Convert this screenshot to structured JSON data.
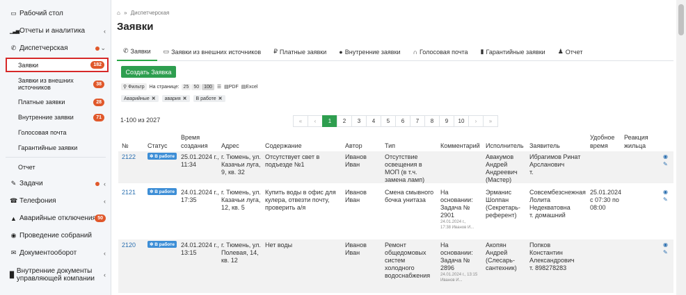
{
  "sidebar": {
    "items": [
      {
        "icon": "desktop-icon",
        "glyph": "🖵",
        "label": "Рабочий стол"
      },
      {
        "icon": "bar-chart-icon",
        "glyph": "▮",
        "label": "Отчеты и аналитика"
      },
      {
        "icon": "phone-icon",
        "glyph": "✆",
        "label": "Диспетчерская"
      }
    ],
    "dispatch_sub": [
      {
        "label": "Заявки",
        "badge": "182",
        "active": true
      },
      {
        "label": "Заявки из внешних источников",
        "badge": "38"
      },
      {
        "label": "Платные заявки",
        "badge": "28"
      },
      {
        "label": "Внутренние заявки",
        "badge": "71"
      },
      {
        "label": "Голосовая почта",
        "badge": ""
      },
      {
        "label": "Гарантийные заявки",
        "badge": ""
      },
      {
        "label": "Отчет",
        "badge": ""
      }
    ],
    "bottom_items": [
      {
        "icon": "edit-icon",
        "glyph": "✎",
        "label": "Задачи"
      },
      {
        "icon": "phone-square-icon",
        "glyph": "☎",
        "label": "Телефония"
      },
      {
        "icon": "warning-icon",
        "glyph": "▲",
        "label": "Аварийные отключения",
        "badge": "50"
      },
      {
        "icon": "users-icon",
        "glyph": "👥",
        "label": "Проведение собраний"
      },
      {
        "icon": "envelope-icon",
        "glyph": "✉",
        "label": "Документооборот"
      },
      {
        "icon": "file-icon",
        "glyph": "▉",
        "label": "Внутренние документы управляющей компании"
      }
    ]
  },
  "breadcrumb": {
    "home_icon": "home-icon",
    "sep": "»",
    "current": "Диспетчерская"
  },
  "page_title": "Заявки",
  "tabs": [
    {
      "icon": "phone-icon",
      "glyph": "✆",
      "label": "Заявки",
      "active": true
    },
    {
      "icon": "hdd-icon",
      "glyph": "▭",
      "label": "Заявки из внешних источников"
    },
    {
      "icon": "hand-icon",
      "glyph": "₽",
      "label": "Платные заявки"
    },
    {
      "icon": "info-icon",
      "glyph": "●",
      "label": "Внутренние заявки"
    },
    {
      "icon": "headset-icon",
      "glyph": "∩",
      "label": "Голосовая почта"
    },
    {
      "icon": "book-icon",
      "glyph": "▮",
      "label": "Гарантийные заявки"
    },
    {
      "icon": "user-chart-icon",
      "glyph": "♟",
      "label": "Отчет"
    }
  ],
  "create_button": "Создать Заявка",
  "toolbar": {
    "filter": "Фильтр",
    "per_page_label": "На странице:",
    "per_page_options": [
      "25",
      "50",
      "100"
    ],
    "per_page_selected": "100",
    "list_icon": "☰",
    "pdf": "PDF",
    "excel": "Excel"
  },
  "active_filters": [
    "Аварийные",
    "авария",
    "В работе"
  ],
  "range_text": "1-100 из 2027",
  "pagination": [
    "«",
    "‹",
    "1",
    "2",
    "3",
    "4",
    "5",
    "6",
    "7",
    "8",
    "9",
    "10",
    "›",
    "»"
  ],
  "pagination_active": "1",
  "table": {
    "headers": {
      "num": "№",
      "status": "Статус",
      "time1": "Время",
      "time2": "создания",
      "address": "Адрес",
      "content": "Содержание",
      "author": "Автор",
      "type": "Тип",
      "comment": "Комментарий",
      "executor": "Исполнитель",
      "applicant": "Заявитель",
      "convenient1": "Удобное",
      "convenient2": "время",
      "reaction1": "Реакция",
      "reaction2": "жильца"
    },
    "rows": [
      {
        "id": "2122",
        "status": "В работе",
        "time": [
          "25.01.2024 г.,",
          "11:34"
        ],
        "address": [
          "г. Тюмень, ул.",
          "Казачьи луга,",
          "9, кв. 32"
        ],
        "content": [
          "Отсутствует свет в",
          "подъезде №1"
        ],
        "author": [
          "Иванов",
          "Иван"
        ],
        "type": [
          "Отсутствие",
          "освещения в",
          "МОП (в т.ч.",
          "замена ламп)"
        ],
        "comment": [],
        "comment_meta": [],
        "executor": [
          "Авакумов",
          "Андрей",
          "Андреевич",
          "(Мастер)"
        ],
        "applicant": [
          "Ибрагимов Ринат",
          "Арсланович",
          "т."
        ],
        "convenient": []
      },
      {
        "id": "2121",
        "status": "В работе",
        "time": [
          "24.01.2024 г.,",
          "17:35"
        ],
        "address": [
          "г. Тюмень, ул.",
          "Казачьи луга,",
          "12, кв. 5"
        ],
        "content": [
          "Купить воды в офис для",
          "кулера, отвезти почту,",
          "проверить а/я"
        ],
        "author": [
          "Иванов",
          "Иван"
        ],
        "type": [
          "Смена смывного",
          "бочка унитаза"
        ],
        "comment": [
          "На",
          "основании:",
          "Задача №",
          "2901"
        ],
        "comment_meta": [
          "24.01.2024 г.,",
          "17:38 Иванов И..."
        ],
        "executor": [
          "Эрманис",
          "Шолпан",
          "(Секретарь-",
          "референт)"
        ],
        "applicant": [
          "Совсембезснежная",
          "Лолита",
          "Недекватовна",
          "т. домашний"
        ],
        "convenient": [
          "25.01.2024",
          "с 07:30 по",
          "08:00"
        ]
      },
      {
        "id": "2120",
        "status": "В работе",
        "time": [
          "24.01.2024 г.,",
          "13:15"
        ],
        "address": [
          "г. Тюмень, ул.",
          "Полевая, 14,",
          "кв. 12"
        ],
        "content": [
          "Нет воды"
        ],
        "author": [
          "Иванов",
          "Иван"
        ],
        "type": [
          "Ремонт",
          "общедомовых",
          "систем",
          "холодного",
          "водоснабжения"
        ],
        "comment": [
          "На",
          "основании:",
          "Задача №",
          "2896"
        ],
        "comment_meta": [
          "24.01.2024 г., 13:15",
          "Иванов И..."
        ],
        "executor": [
          "Акопян",
          "Андрей",
          "(Слесарь-",
          "сантехник)"
        ],
        "applicant": [
          "Попков",
          "Константин",
          "Александрович",
          "т. 898278283"
        ],
        "convenient": []
      }
    ]
  },
  "colors": {
    "accent": "#2e9e4f",
    "badge": "#e0582b",
    "status": "#3d8ed6",
    "highlight": "#d62828"
  }
}
